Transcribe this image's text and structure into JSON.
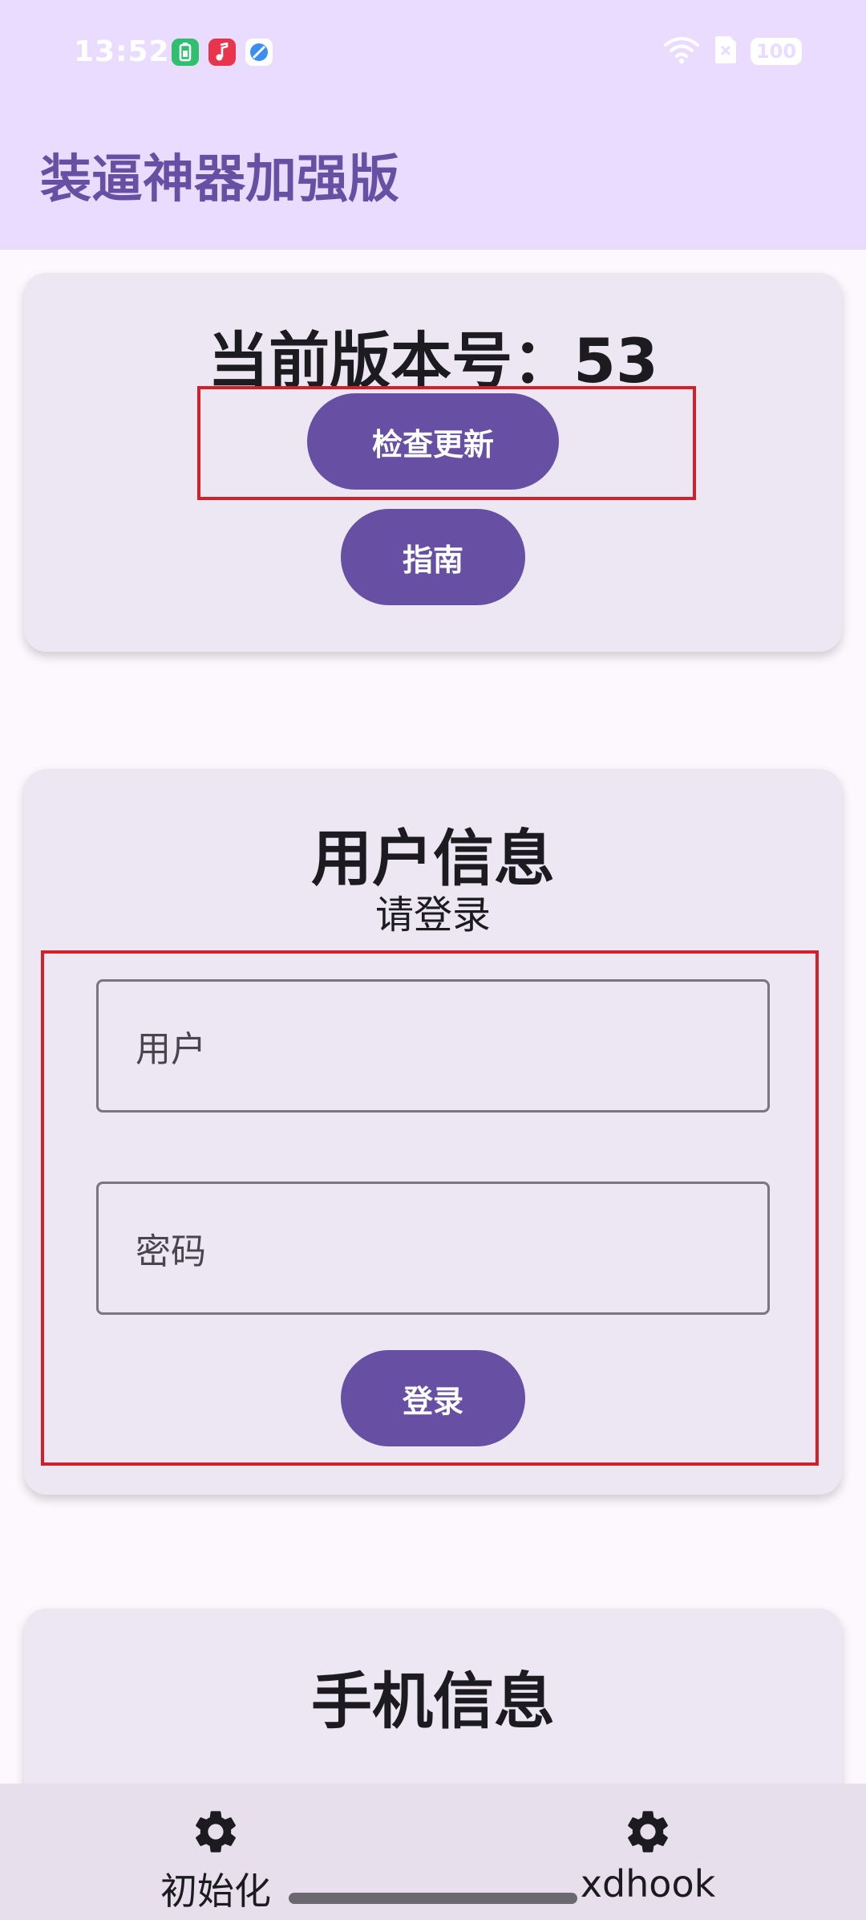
{
  "status_bar": {
    "time": "13:52",
    "battery": "100",
    "icons": [
      "battery-saver-app-icon",
      "music-app-icon",
      "browser-app-icon",
      "wifi-icon",
      "sim-icon"
    ]
  },
  "app_bar": {
    "title": "装逼神器加强版"
  },
  "version_card": {
    "version_text": "当前版本号：53",
    "check_update_label": "检查更新",
    "guide_label": "指南"
  },
  "user_card": {
    "title": "用户信息",
    "subtitle": "请登录",
    "username_placeholder": "用户",
    "password_placeholder": "密码",
    "login_label": "登录"
  },
  "phone_card": {
    "title": "手机信息"
  },
  "bottom_nav": {
    "items": [
      {
        "label": "初始化",
        "icon": "gear-icon"
      },
      {
        "label": "xdhook",
        "icon": "gear-icon"
      }
    ]
  },
  "colors": {
    "primary": "#6750a4",
    "top_bar": "#eadcff",
    "card": "#ede7f3",
    "highlight": "#d1202a"
  }
}
